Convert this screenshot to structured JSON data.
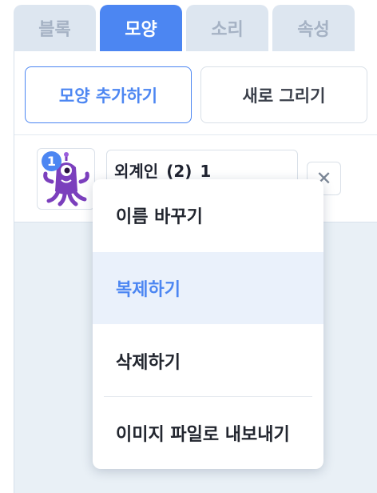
{
  "tabs": [
    {
      "label": "블록",
      "active": false
    },
    {
      "label": "모양",
      "active": true
    },
    {
      "label": "소리",
      "active": false
    },
    {
      "label": "속성",
      "active": false
    }
  ],
  "actions": {
    "add_shape_label": "모양 추가하기",
    "new_drawing_label": "새로 그리기"
  },
  "shape_item": {
    "number": "1",
    "name": "외계인_(2)_1",
    "thumbnail_icon": "purple-alien-icon",
    "delete_icon": "close-icon"
  },
  "context_menu": {
    "items": [
      {
        "label": "이름 바꾸기",
        "highlighted": false
      },
      {
        "label": "복제하기",
        "highlighted": true
      },
      {
        "label": "삭제하기",
        "highlighted": false
      },
      {
        "label": "이미지 파일로 내보내기",
        "highlighted": false
      }
    ]
  },
  "colors": {
    "accent": "#4c86f2",
    "tab_inactive": "#dde6f0",
    "panel_bg": "#e9f0f6",
    "menu_highlight": "#eaf1fb",
    "alien_purple": "#7b3fbd"
  }
}
